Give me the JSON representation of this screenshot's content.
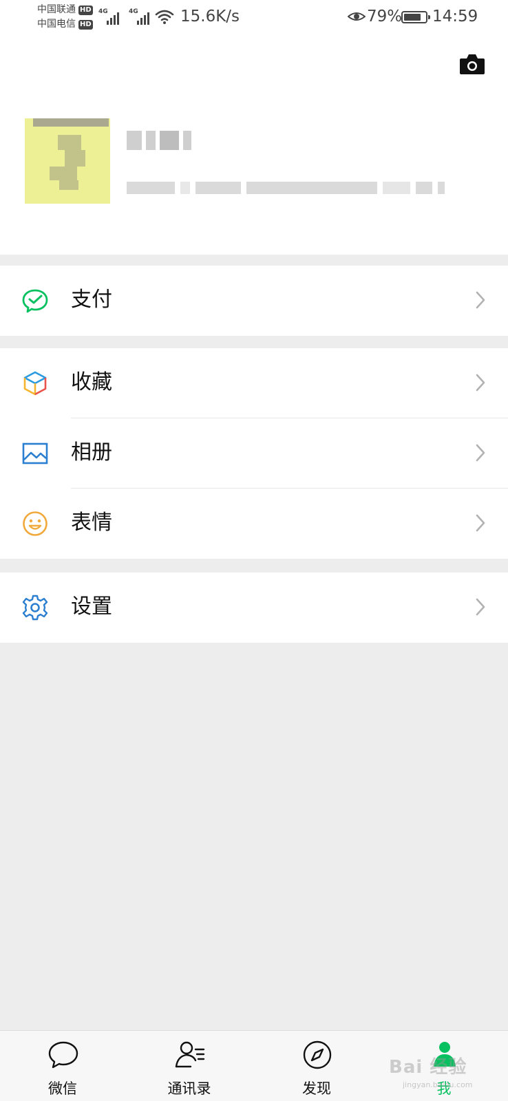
{
  "status_bar": {
    "carrier_1": "中国联通",
    "carrier_2": "中国电信",
    "hd_badge": "HD",
    "net_tag_1": "4G",
    "net_tag_2": "4G",
    "net_speed": "15.6K/s",
    "battery_percent": "79%",
    "battery_level": 0.79,
    "time": "14:59"
  },
  "profile": {
    "nickname": "",
    "wechat_id": ""
  },
  "menu": {
    "payment": "支付",
    "favorites": "收藏",
    "album": "相册",
    "stickers": "表情",
    "settings": "设置"
  },
  "tabs": [
    {
      "label": "微信",
      "icon": "chat-bubble-icon"
    },
    {
      "label": "通讯录",
      "icon": "contacts-icon"
    },
    {
      "label": "发现",
      "icon": "compass-icon"
    },
    {
      "label": "我",
      "icon": "me-icon",
      "active": true
    }
  ],
  "watermark": {
    "text": "Bai 经验",
    "sub": "jingyan.baidu.com"
  },
  "colors": {
    "accent_green": "#07c160",
    "background": "#ededed",
    "surface": "#ffffff"
  }
}
